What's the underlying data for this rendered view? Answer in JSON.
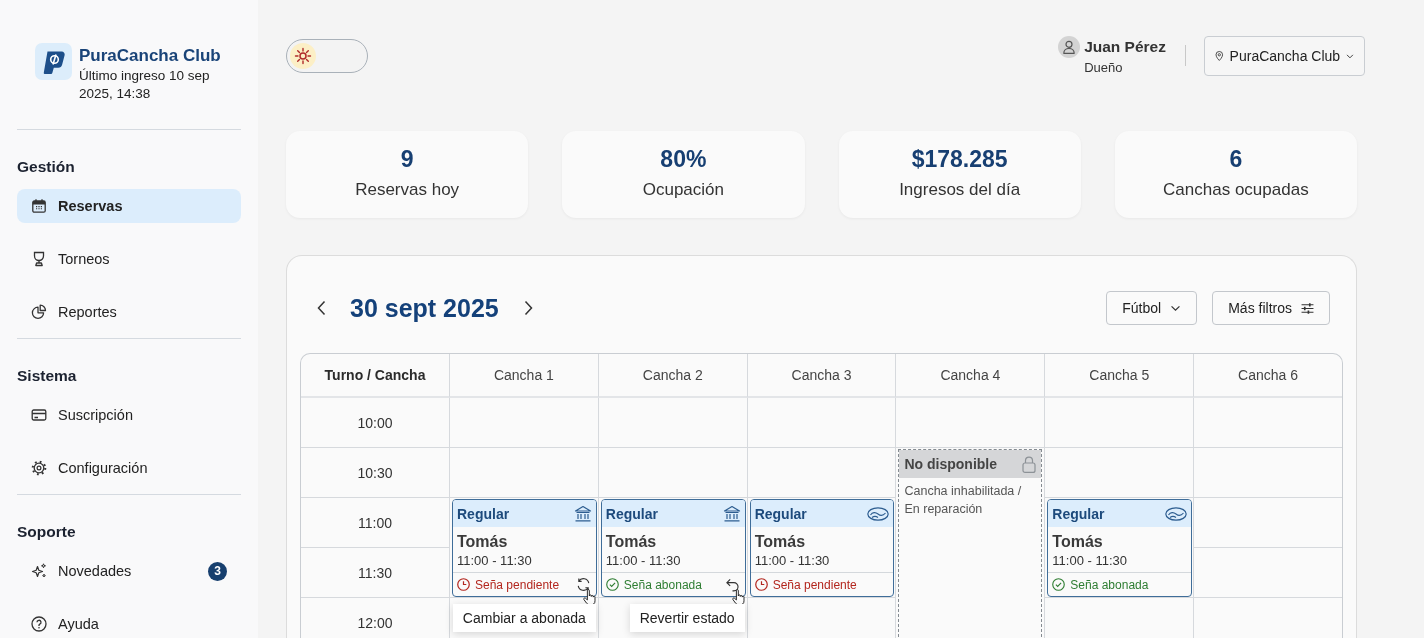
{
  "sidebar": {
    "brand": {
      "name": "PuraCancha Club",
      "last_login": "Último ingreso 10 sep 2025, 14:38"
    },
    "sections": [
      {
        "title": "Gestión",
        "items": [
          {
            "label": "Reservas",
            "selected": true
          },
          {
            "label": "Torneos",
            "selected": false
          },
          {
            "label": "Reportes",
            "selected": false
          }
        ]
      },
      {
        "title": "Sistema",
        "items": [
          {
            "label": "Suscripción",
            "selected": false
          },
          {
            "label": "Configuración",
            "selected": false
          }
        ]
      },
      {
        "title": "Soporte",
        "items": [
          {
            "label": "Novedades",
            "selected": false,
            "badge": "3"
          },
          {
            "label": "Ayuda",
            "selected": false
          }
        ]
      }
    ]
  },
  "header": {
    "theme_toggle": {
      "dark": false
    },
    "user": {
      "name": "Juan Pérez",
      "role": "Dueño"
    },
    "club_select": {
      "value": "PuraCancha Club"
    }
  },
  "stats": [
    {
      "value": "9",
      "label": "Reservas hoy"
    },
    {
      "value": "80%",
      "label": "Ocupación"
    },
    {
      "value": "$178.285",
      "label": "Ingresos del día"
    },
    {
      "value": "6",
      "label": "Canchas ocupadas"
    }
  ],
  "calendar": {
    "date": "30 sept 2025",
    "sport_filter": "Fútbol",
    "more_filters": "Más filtros",
    "corner_header": "Turno / Cancha",
    "slots": [
      "10:00",
      "10:30",
      "11:00",
      "11:30",
      "12:00"
    ],
    "courts": [
      {
        "name": "Cancha 1",
        "cells": [
          {
            "kind": "free"
          },
          {
            "kind": "free"
          },
          {
            "kind": "booking",
            "type": "Regular",
            "payment": {
              "kind": "transfer"
            },
            "client": "Tomás",
            "time": "11:00 - 11:30",
            "paid": false,
            "status": "Seña pendiente",
            "action": {
              "kind": "mark_paid",
              "hovered": true,
              "tooltip": "Cambiar a abonada"
            }
          },
          {
            "kind": "span"
          },
          {
            "kind": "free"
          }
        ]
      },
      {
        "name": "Cancha 2",
        "cells": [
          {
            "kind": "free"
          },
          {
            "kind": "free"
          },
          {
            "kind": "booking",
            "type": "Regular",
            "payment": {
              "kind": "transfer"
            },
            "client": "Tomás",
            "time": "11:00 - 11:30",
            "paid": true,
            "status": "Seña abonada",
            "action": {
              "kind": "revert",
              "hovered": true,
              "tooltip": "Revertir estado"
            }
          },
          {
            "kind": "span"
          },
          {
            "kind": "free"
          }
        ]
      },
      {
        "name": "Cancha 3",
        "cells": [
          {
            "kind": "free"
          },
          {
            "kind": "free"
          },
          {
            "kind": "booking",
            "type": "Regular",
            "payment": {
              "kind": "cash"
            },
            "client": "Tomás",
            "time": "11:00 - 11:30",
            "paid": false,
            "status": "Seña pendiente"
          },
          {
            "kind": "span"
          },
          {
            "kind": "free"
          }
        ]
      },
      {
        "name": "Cancha 4",
        "cells": [
          {
            "kind": "free"
          },
          {
            "kind": "unavailable",
            "title": "No disponible",
            "note": "Cancha inhabilitada / En reparación"
          },
          {
            "kind": "span"
          },
          {
            "kind": "span"
          },
          {
            "kind": "span"
          }
        ]
      },
      {
        "name": "Cancha 5",
        "cells": [
          {
            "kind": "free"
          },
          {
            "kind": "free"
          },
          {
            "kind": "booking",
            "type": "Regular",
            "payment": {
              "kind": "cash"
            },
            "client": "Tomás",
            "time": "11:00 - 11:30",
            "paid": true,
            "status": "Seña abonada"
          },
          {
            "kind": "span"
          },
          {
            "kind": "free"
          }
        ]
      },
      {
        "name": "Cancha 6",
        "cells": [
          {
            "kind": "free"
          },
          {
            "kind": "free"
          },
          {
            "kind": "free"
          },
          {
            "kind": "free"
          },
          {
            "kind": "free"
          }
        ]
      }
    ]
  }
}
